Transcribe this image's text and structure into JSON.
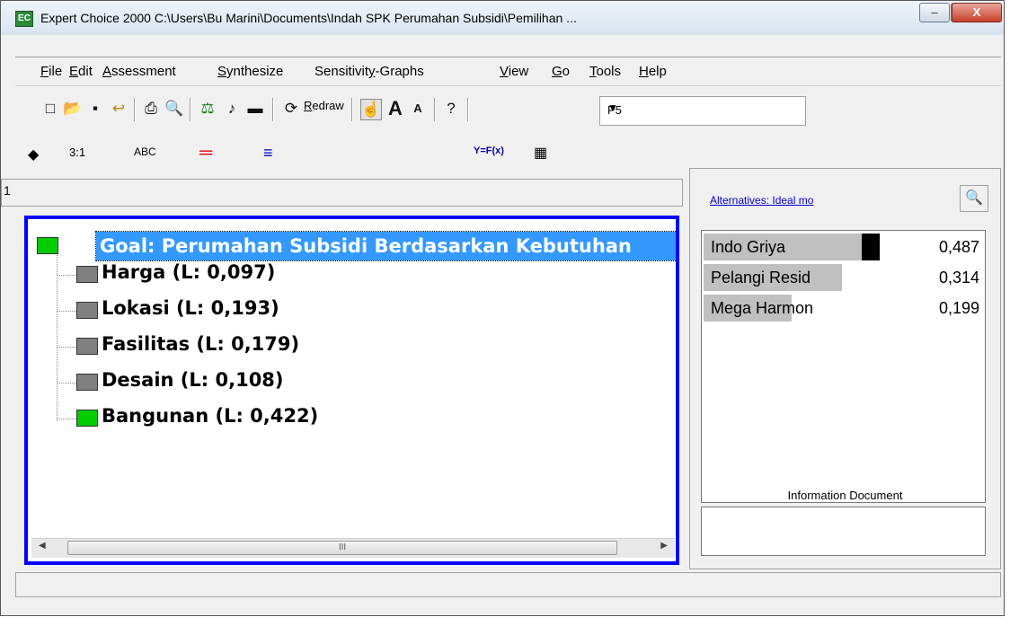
{
  "window": {
    "app_icon_text": "EC",
    "title": "Expert Choice 2000     C:\\Users\\Bu Marini\\Documents\\Indah SPK Perumahan Subsidi\\Pemilihan ...",
    "minimize_label": "–",
    "maximize_label": "□",
    "close_label": "X"
  },
  "menu": {
    "items": [
      {
        "accel": "F",
        "rest": "ile"
      },
      {
        "accel": "E",
        "rest": "dit"
      },
      {
        "accel": "A",
        "rest": "ssessment"
      },
      {
        "accel": "S",
        "rest": "ynthesize"
      },
      {
        "pre": "Sensitivit",
        "accel": "y",
        "rest": "-Graphs"
      },
      {
        "accel": "V",
        "rest": "iew"
      },
      {
        "accel": "G",
        "rest": "o"
      },
      {
        "accel": "T",
        "rest": "ools"
      },
      {
        "accel": "H",
        "rest": "elp"
      }
    ]
  },
  "toolbar": {
    "icons": {
      "new": "□",
      "open": "📂",
      "save": "▪",
      "undo": "↩",
      "print": "⎙",
      "preview": "🔍",
      "judge": "⚖",
      "sound": "♪",
      "stop": "▬",
      "redraw_icon": "⟳",
      "pointer": "☝",
      "font_up": "A",
      "font_down": "A",
      "help": "?"
    },
    "redraw_accel": "R",
    "redraw_rest": "edraw",
    "combo_value": "P5",
    "combo_arrow": "▼"
  },
  "tabs": {
    "items": [
      "3:1",
      "ABC",
      "Y=F(x)"
    ]
  },
  "model_pane": {
    "header_text": "1",
    "goal": "Goal: Perumahan Subsidi Berdasarkan Kebutuhan",
    "goal_color": "#00cc00",
    "criteria": [
      {
        "label": "Harga (L: 0,097)",
        "color": "#808080"
      },
      {
        "label": "Lokasi (L: 0,193)",
        "color": "#808080"
      },
      {
        "label": "Fasilitas (L: 0,179)",
        "color": "#808080"
      },
      {
        "label": "Desain (L: 0,108)",
        "color": "#808080"
      },
      {
        "label": "Bangunan (L: 0,422)",
        "color": "#00cc00"
      }
    ],
    "scroll_left": "◀",
    "scroll_thumb": "III",
    "scroll_right": "▶"
  },
  "alternatives_pane": {
    "link_text": "Alternatives: Ideal mo",
    "button_icon": "🔍",
    "items": [
      {
        "name": "Indo Griya",
        "value": "0,487",
        "score": 0.487
      },
      {
        "name": "Pelangi Resid",
        "value": "0,314",
        "score": 0.314
      },
      {
        "name": "Mega Harmon",
        "value": "0,199",
        "score": 0.199
      }
    ],
    "info_label": "Information Document"
  }
}
